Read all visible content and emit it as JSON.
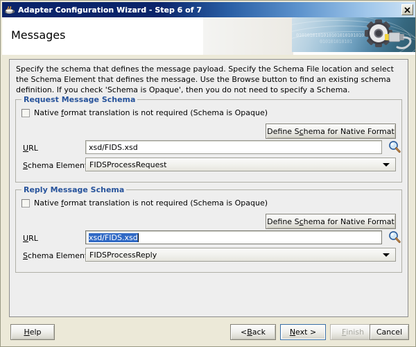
{
  "window": {
    "title": "Adapter Configuration Wizard - Step 6 of 7",
    "icon": "java-coffee-cup-icon",
    "close_label": "✕"
  },
  "header": {
    "title": "Messages",
    "art_binary_top": "0101010101010101010101010101",
    "art_binary_bottom": "010101010101"
  },
  "main": {
    "description": "Specify the schema that defines the message payload.  Specify the Schema File location and select the Schema Element that defines the message. Use the Browse button to find an existing schema definition. If you check 'Schema is Opaque', then you do not need to specify a Schema."
  },
  "request_group": {
    "title": "Request Message Schema",
    "checkbox": {
      "label_before": "Native ",
      "label_accel": "f",
      "label_after": "ormat translation is not required (Schema is Opaque)",
      "checked": false
    },
    "define_button": {
      "label_before": "Define S",
      "label_accel": "c",
      "label_after": "hema for Native Format"
    },
    "url_label_accel": "U",
    "url_label_rest": "RL",
    "url_value": "xsd/FIDS.xsd",
    "element_label_accel": "S",
    "element_label_rest": "chema Element",
    "element_value": "FIDSProcessRequest",
    "browse_icon": "magnifier-icon"
  },
  "reply_group": {
    "title": "Reply Message Schema",
    "checkbox": {
      "label_before": "Native ",
      "label_accel": "f",
      "label_after": "ormat translation is not required (Schema is Opaque)",
      "checked": false
    },
    "define_button": {
      "label_before": "Define S",
      "label_accel": "c",
      "label_after": "hema for Native Format"
    },
    "url_label_accel": "U",
    "url_label_rest": "RL",
    "url_value": "xsd/FIDS.xsd",
    "url_selected": true,
    "element_label_accel": "S",
    "element_label_rest": "chema Element",
    "element_value": "FIDSProcessReply",
    "browse_icon": "magnifier-icon"
  },
  "footer": {
    "help": {
      "accel": "H",
      "rest": "elp"
    },
    "back": {
      "before": "< ",
      "accel": "B",
      "rest": "ack"
    },
    "next": {
      "accel": "N",
      "rest": "ext >",
      "focused": true
    },
    "finish": {
      "accel": "F",
      "rest": "inish",
      "disabled": true
    },
    "cancel": {
      "label": "Cancel"
    }
  },
  "colors": {
    "group_title": "#27539b",
    "selection": "#316ac5",
    "titlebar_start": "#0a246a",
    "panel_bg": "#eeeeee",
    "dialog_bg": "#ece9d8"
  }
}
